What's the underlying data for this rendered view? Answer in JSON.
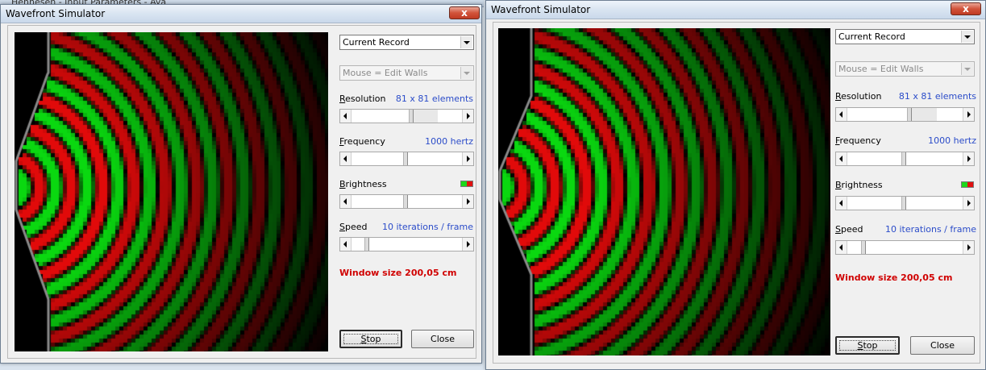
{
  "background_window": {
    "title": "Hennesen - Input Parameters - Aya"
  },
  "windows": [
    {
      "id": "left",
      "title": "Wavefront Simulator",
      "record_select": "Current Record",
      "mouse_mode_select": "Mouse = Edit Walls",
      "resolution": {
        "label": "Resolution",
        "mnemonic": "R",
        "rest": "esolution",
        "value_text": "81 x 81 elements",
        "position": 0.52
      },
      "frequency": {
        "label": "Frequency",
        "mnemonic": "F",
        "rest": "requency",
        "value_text": "1000 hertz",
        "position": 0.47
      },
      "brightness": {
        "label": "Brightness",
        "mnemonic": "B",
        "rest": "rightness",
        "position": 0.47
      },
      "speed": {
        "label": "Speed",
        "mnemonic": "S",
        "rest": "peed",
        "value_text": "10 iterations / frame",
        "position": 0.12
      },
      "window_size_text": "Window size 200,05 cm",
      "stop_label": "Stop",
      "stop_mnemonic": "S",
      "stop_rest": "top",
      "close_label": "Close",
      "close_x": "x"
    },
    {
      "id": "right",
      "title": "Wavefront Simulator",
      "record_select": "Current Record",
      "mouse_mode_select": "Mouse = Edit Walls",
      "resolution": {
        "label": "Resolution",
        "mnemonic": "R",
        "rest": "esolution",
        "value_text": "81 x 81 elements",
        "position": 0.52
      },
      "frequency": {
        "label": "Frequency",
        "mnemonic": "F",
        "rest": "requency",
        "value_text": "1000 hertz",
        "position": 0.47
      },
      "brightness": {
        "label": "Brightness",
        "mnemonic": "B",
        "rest": "rightness",
        "position": 0.47
      },
      "speed": {
        "label": "Speed",
        "mnemonic": "S",
        "rest": "peed",
        "value_text": "10 iterations / frame",
        "position": 0.12
      },
      "window_size_text": "Window size 200,05 cm",
      "stop_label": "Stop",
      "stop_mnemonic": "S",
      "stop_rest": "top",
      "close_label": "Close",
      "close_x": "x"
    }
  ],
  "colors": {
    "wave_positive": "#e01010",
    "wave_negative": "#10d810",
    "wall": "#8a8a8a",
    "value_text": "#2b4cc9",
    "window_size_text": "#d00000"
  }
}
